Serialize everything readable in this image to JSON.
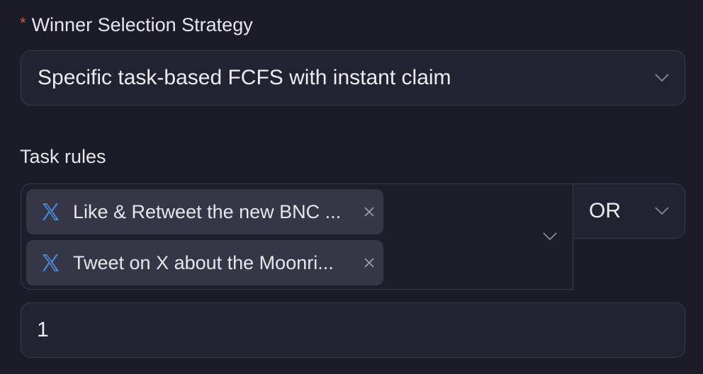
{
  "winner_strategy": {
    "required_marker": "*",
    "label": "Winner Selection Strategy",
    "selected_value": "Specific task-based FCFS with instant claim",
    "chevron_icon": "chevron-down-icon"
  },
  "task_rules": {
    "label": "Task rules",
    "tags": [
      {
        "platform_icon": "x-logo-icon",
        "text": "Like & Retweet the new BNC ...",
        "remove_icon": "close-icon"
      },
      {
        "platform_icon": "x-logo-icon",
        "text": "Tweet on X about the Moonri...",
        "remove_icon": "close-icon"
      }
    ],
    "dropdown_icon": "chevron-down-icon",
    "logic_operator": "OR"
  },
  "count_input": {
    "value": "1"
  },
  "colors": {
    "background": "#1b1c28",
    "field_bg": "#222330",
    "border": "#3b3c4a",
    "tag_bg": "#363746",
    "required": "#e0533d",
    "x_logo": "#4a90e2"
  }
}
